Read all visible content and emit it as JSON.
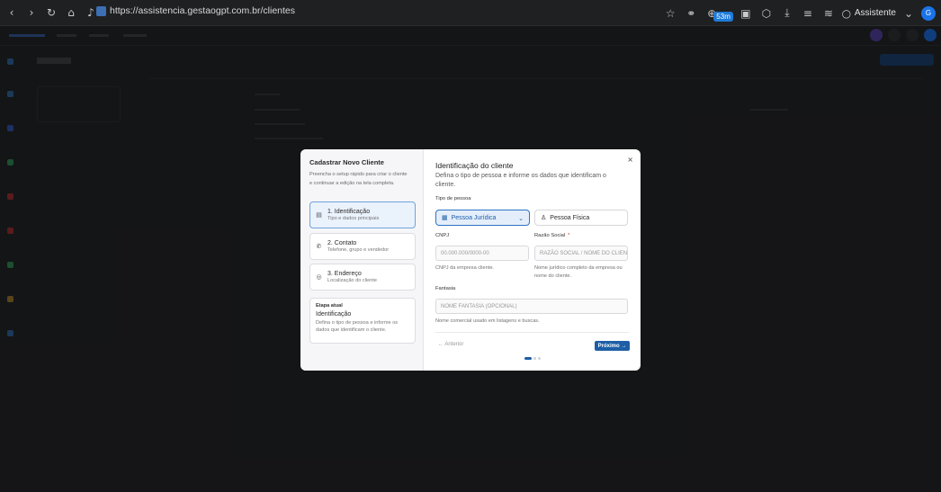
{
  "browser": {
    "url": "https://assistencia.gestaogpt.com.br/clientes",
    "badge": "53m",
    "assistant_label": "Assistente"
  },
  "modal": {
    "sidebar": {
      "title": "Cadastrar Novo Cliente",
      "description": "Preencha o setup rápido para criar o cliente e continuar a edição na tela completa.",
      "steps": [
        {
          "label": "1. Identificação",
          "sub": "Tipo e dados principais",
          "icon": "document-icon"
        },
        {
          "label": "2. Contato",
          "sub": "Telefone, grupo e vendedor",
          "icon": "phone-icon"
        },
        {
          "label": "3. Endereço",
          "sub": "Localização do cliente",
          "icon": "location-pin-icon"
        }
      ],
      "current_stage": {
        "heading": "Etapa atual",
        "name": "Identificação",
        "description": "Defina o tipo de pessoa e informe os dados que identificam o cliente."
      }
    },
    "main": {
      "title": "Identificação do cliente",
      "description": "Defina o tipo de pessoa e informe os dados que identificam o cliente.",
      "person_type_label": "Tipo de pessoa",
      "person_types": {
        "juridica": "Pessoa Jurídica",
        "fisica": "Pessoa Física"
      },
      "selected_person_type": "Pessoa Jurídica",
      "cnpj": {
        "label": "CNPJ",
        "placeholder": "00.000.000/0000-00",
        "value": "",
        "help": "CNPJ da empresa cliente."
      },
      "razao_social": {
        "label": "Razão Social",
        "required_mark": "*",
        "placeholder": "RAZÃO SOCIAL / NOME DO CLIENTE",
        "value": "",
        "help": "Nome jurídico completo da empresa ou nome do cliente."
      },
      "fantasia": {
        "label": "Fantasia",
        "placeholder": "NOME FANTASIA (OPCIONAL)",
        "value": "",
        "help": "Nome comercial usado em listagens e buscas."
      },
      "prev_label": "← Anterior",
      "next_label": "Próximo →",
      "close_label": "×",
      "progress": {
        "current": 1,
        "total": 3
      }
    },
    "colors": {
      "accent": "#1d5ea6",
      "required": "#d33333"
    }
  }
}
